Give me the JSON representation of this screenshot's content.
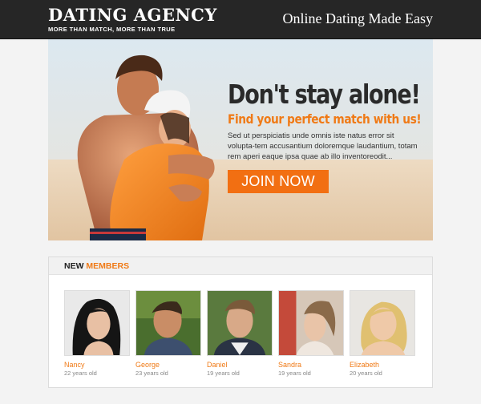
{
  "header": {
    "title": "DATING AGENCY",
    "tagline": "MORE THAN MATCH, MORE THAN TRUE",
    "slogan": "Online Dating Made Easy"
  },
  "hero": {
    "title": "Don't stay alone!",
    "subtitle": "Find your perfect match with us!",
    "description": "Sed ut perspiciatis unde omnis iste natus error sit volupta-tem accusantium doloremque laudantium, totam rem aperi eaque ipsa quae ab illo inventoreodit...",
    "cta_label": "JOIN NOW"
  },
  "members": {
    "heading_word1": "NEW",
    "heading_word2": "MEMBERS",
    "items": [
      {
        "name": "Nancy",
        "age": "22 years old"
      },
      {
        "name": "George",
        "age": "23 years old"
      },
      {
        "name": "Daniel",
        "age": "19 years old"
      },
      {
        "name": "Sandra",
        "age": "19 years old"
      },
      {
        "name": "Elizabeth",
        "age": "20 years old"
      }
    ]
  },
  "colors": {
    "header_bg": "#262626",
    "accent": "#f07a16",
    "button_bg": "#f26f12",
    "page_bg": "#f3f3f3"
  }
}
